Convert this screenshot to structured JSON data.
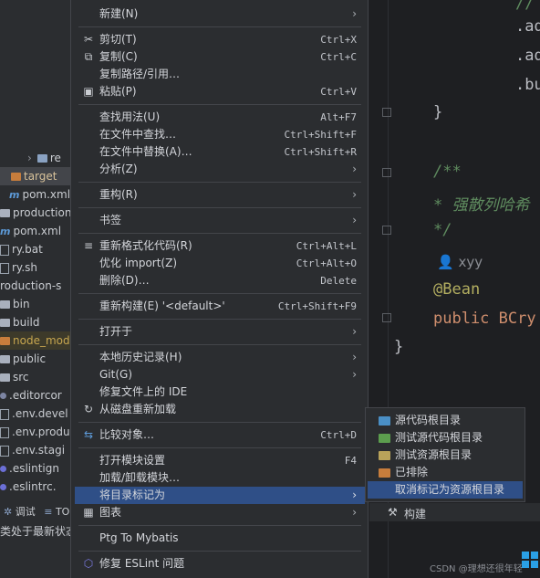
{
  "tree": {
    "rows": [
      {
        "label": "re",
        "kind": "folder-blue",
        "indent": true
      },
      {
        "label": "target",
        "kind": "folder-orange"
      },
      {
        "label": "pom.xml",
        "kind": "m"
      },
      {
        "label": "production",
        "kind": "file"
      },
      {
        "label": "pom.xml",
        "kind": "m"
      },
      {
        "label": "ry.bat",
        "kind": "file"
      },
      {
        "label": "ry.sh",
        "kind": "file"
      },
      {
        "label": "roduction-s",
        "kind": "none"
      },
      {
        "label": "bin",
        "kind": "folder"
      },
      {
        "label": "build",
        "kind": "folder"
      },
      {
        "label": "node_modu",
        "kind": "folder-orange"
      },
      {
        "label": "public",
        "kind": "folder"
      },
      {
        "label": "src",
        "kind": "folder"
      },
      {
        "label": ".editorcor",
        "kind": "dot"
      },
      {
        "label": ".env.devel",
        "kind": "file"
      },
      {
        "label": ".env.produ",
        "kind": "file"
      },
      {
        "label": ".env.stagi",
        "kind": "file"
      },
      {
        "label": ".eslintign",
        "kind": "dot"
      },
      {
        "label": ".eslintrc.",
        "kind": "dot"
      }
    ]
  },
  "bottom": {
    "tab_debug": "调试",
    "tab_to": "TO",
    "status_text": "类处于最新状态",
    "build_tab": "构建"
  },
  "editor": {
    "lines": [
      {
        "text": ".ad",
        "color": "#bcbec4"
      },
      {
        "text": ".ad",
        "color": "#bcbec4"
      },
      {
        "text": ".bu",
        "color": "#bcbec4"
      },
      {
        "text": "}",
        "color": "#bcbec4"
      },
      {
        "text": "/**",
        "color": "#5f8c5f"
      },
      {
        "text": " * 强散列哈希",
        "color": "#5f8c5f"
      },
      {
        "text": " */",
        "color": "#5f8c5f"
      },
      {
        "text": "xyy",
        "color": "#8a8d93"
      },
      {
        "text": "@Bean",
        "color": "#b3ae60"
      },
      {
        "text": "public BCry",
        "color": "#cf8e6d"
      },
      {
        "text": "}",
        "color": "#bcbec4"
      }
    ]
  },
  "menu": {
    "items": [
      {
        "label": "新建(N)",
        "shortcut": "",
        "submenu": true,
        "icon": ""
      },
      {
        "label": "剪切(T)",
        "shortcut": "Ctrl+X",
        "submenu": false,
        "icon": "✂"
      },
      {
        "label": "复制(C)",
        "shortcut": "Ctrl+C",
        "submenu": false,
        "icon": "⧉"
      },
      {
        "label": "复制路径/引用…",
        "shortcut": "",
        "submenu": false,
        "icon": ""
      },
      {
        "label": "粘贴(P)",
        "shortcut": "Ctrl+V",
        "submenu": false,
        "icon": "📋"
      },
      {
        "label": "查找用法(U)",
        "shortcut": "Alt+F7",
        "submenu": false,
        "icon": ""
      },
      {
        "label": "在文件中查找…",
        "shortcut": "Ctrl+Shift+F",
        "submenu": false,
        "icon": ""
      },
      {
        "label": "在文件中替换(A)…",
        "shortcut": "Ctrl+Shift+R",
        "submenu": false,
        "icon": ""
      },
      {
        "label": "分析(Z)",
        "shortcut": "",
        "submenu": true,
        "icon": ""
      },
      {
        "label": "重构(R)",
        "shortcut": "",
        "submenu": true,
        "icon": ""
      },
      {
        "label": "书签",
        "shortcut": "",
        "submenu": true,
        "icon": ""
      },
      {
        "label": "重新格式化代码(R)",
        "shortcut": "Ctrl+Alt+L",
        "submenu": false,
        "icon": "≡"
      },
      {
        "label": "优化 import(Z)",
        "shortcut": "Ctrl+Alt+O",
        "submenu": false,
        "icon": ""
      },
      {
        "label": "删除(D)…",
        "shortcut": "Delete",
        "submenu": false,
        "icon": ""
      },
      {
        "label": "重新构建(E) '<default>'",
        "shortcut": "Ctrl+Shift+F9",
        "submenu": false,
        "icon": ""
      },
      {
        "label": "打开于",
        "shortcut": "",
        "submenu": true,
        "icon": ""
      },
      {
        "label": "本地历史记录(H)",
        "shortcut": "",
        "submenu": true,
        "icon": ""
      },
      {
        "label": "Git(G)",
        "shortcut": "",
        "submenu": true,
        "icon": ""
      },
      {
        "label": "修复文件上的 IDE",
        "shortcut": "",
        "submenu": false,
        "icon": ""
      },
      {
        "label": "从磁盘重新加载",
        "shortcut": "",
        "submenu": false,
        "icon": "↻"
      },
      {
        "label": "比较对象…",
        "shortcut": "Ctrl+D",
        "submenu": false,
        "icon": "⇆"
      },
      {
        "label": "打开模块设置",
        "shortcut": "F4",
        "submenu": false,
        "icon": ""
      },
      {
        "label": "加载/卸载模块…",
        "shortcut": "",
        "submenu": false,
        "icon": ""
      },
      {
        "label": "将目录标记为",
        "shortcut": "",
        "submenu": true,
        "icon": ""
      },
      {
        "label": "图表",
        "shortcut": "",
        "submenu": true,
        "icon": "▦"
      },
      {
        "label": "Ptg To Mybatis",
        "shortcut": "",
        "submenu": false,
        "icon": ""
      },
      {
        "label": "修复 ESLint 问题",
        "shortcut": "",
        "submenu": false,
        "icon": "⬡"
      }
    ]
  },
  "submenu": {
    "items": [
      {
        "label": "源代码根目录",
        "color": "#4a8fc6"
      },
      {
        "label": "测试源代码根目录",
        "color": "#5c9e4e"
      },
      {
        "label": "测试资源根目录",
        "color": "#b9a35a"
      },
      {
        "label": "已排除",
        "color": "#c77d3c"
      },
      {
        "label": "取消标记为资源根目录",
        "color": ""
      }
    ]
  },
  "watermark": "CSDN @理想还很年轻"
}
